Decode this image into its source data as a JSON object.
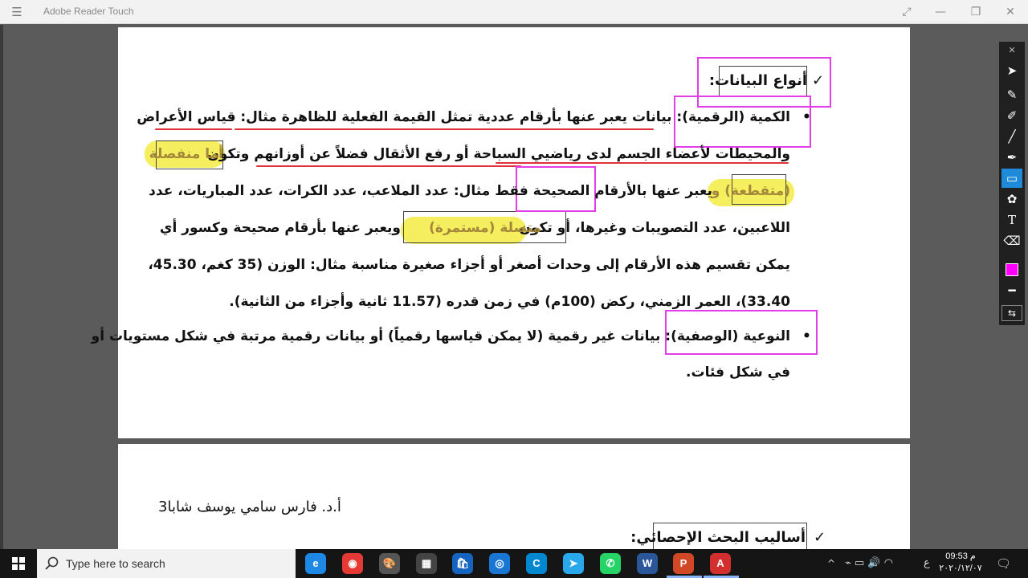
{
  "window": {
    "title": "Adobe Reader Touch",
    "menu_glyph": "☰",
    "fullscreen_glyph": "⤢",
    "minimize_glyph": "—",
    "restore_glyph": "❐",
    "close_glyph": "✕"
  },
  "document": {
    "heading_check": "✓",
    "heading": "أنواع البيانات:",
    "bullet": "•",
    "line1": "الكمية (الرقمية): بيانات يعبر عنها بأرقام عددية تمثل القيمة الفعلية للظاهرة مثال: قياس الأعراض",
    "line2_a": "والمحيطات لأعضاء الجسم لدى رياضيي السباحة أو رفع الأثقال فضلاً عن أوزانهم وتكون",
    "line2_b": "أما منفصلة",
    "line3_a": "(متقطعة) و",
    "line3_b": "يعبر عنها بالأرقام الصحيحة فقط مثال: عدد الملاعب، عدد الكرات، عدد المباريات، عدد",
    "line4_a": "اللاعبين، عدد التصويبات وغيرها، أو تكون",
    "line4_b": "متصلة (مستمرة)",
    "line4_c": "ويعبر عنها بأرقام صحيحة وكسور أي",
    "line5": "يمكن تقسيم هذه الأرقام إلى وحدات أصغر أو أجزاء صغيرة مناسبة مثال: الوزن (35 كغم، 45.30،",
    "line6": "33.40)، العمر الزمني، ركض (100م) في زمن قدره (11.57 ثانية وأجزاء من الثانية).",
    "line7": "النوعية (الوصفية): بيانات غير رقمية (لا يمكن قياسها رقمياً) أو بيانات رقمية مرتبة في شكل مستويات أو",
    "line8": "في شكل فئات.",
    "page2_author": "أ.د. فارس سامي يوسف شابا3",
    "page2_heading": "أساليب البحث الإحصائي:"
  },
  "toolbar": {
    "close_glyph": "✕",
    "tools": [
      {
        "name": "select",
        "glyph": "➤"
      },
      {
        "name": "pen",
        "glyph": "✎"
      },
      {
        "name": "marker",
        "glyph": "✐"
      },
      {
        "name": "line",
        "glyph": "╱"
      },
      {
        "name": "highlighter",
        "glyph": "✒"
      },
      {
        "name": "rectangle",
        "glyph": "▭"
      },
      {
        "name": "stamp",
        "glyph": "✿"
      },
      {
        "name": "text",
        "glyph": "T"
      },
      {
        "name": "eraser",
        "glyph": "⌫"
      },
      {
        "name": "line-weight",
        "glyph": "━"
      },
      {
        "name": "expand",
        "glyph": "⇆"
      }
    ],
    "active_tool": "rectangle",
    "color": "#ff00ff"
  },
  "taskbar": {
    "search_placeholder": "Type here to search",
    "apps": [
      {
        "name": "edge",
        "glyph": "e",
        "color": "#1e88e5"
      },
      {
        "name": "chrome",
        "glyph": "◉",
        "color": "#e53935"
      },
      {
        "name": "paint",
        "glyph": "🎨",
        "color": "#555555"
      },
      {
        "name": "calculator",
        "glyph": "▦",
        "color": "#444444"
      },
      {
        "name": "store",
        "glyph": "🛍",
        "color": "#1565c0"
      },
      {
        "name": "network",
        "glyph": "◎",
        "color": "#1976d2"
      },
      {
        "name": "c-app",
        "glyph": "C",
        "color": "#0288d1"
      },
      {
        "name": "telegram",
        "glyph": "➤",
        "color": "#29a9eb"
      },
      {
        "name": "whatsapp",
        "glyph": "✆",
        "color": "#25d366"
      },
      {
        "name": "word",
        "glyph": "W",
        "color": "#2b579a"
      },
      {
        "name": "powerpoint",
        "glyph": "P",
        "color": "#d24726"
      },
      {
        "name": "acrobat",
        "glyph": "A",
        "color": "#d32f2f"
      }
    ],
    "tray_chevron": "^",
    "tray_lang": "ع",
    "time": "09:53 م",
    "date": "٢٠٢٠/١٢/٠٧",
    "notification_glyph": "🗨"
  }
}
